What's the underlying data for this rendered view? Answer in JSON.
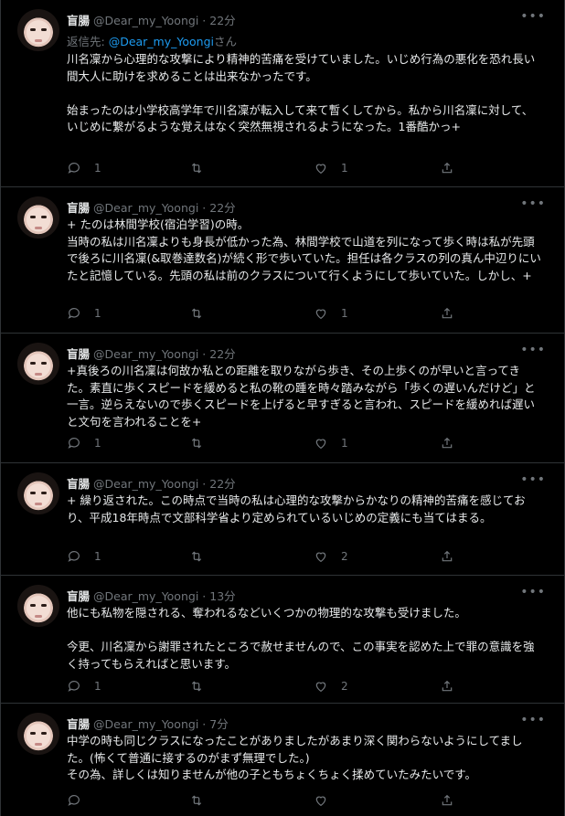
{
  "tweets": [
    {
      "name": "盲腸",
      "handle": "@Dear_my_Yoongi",
      "sep": "·",
      "time": "22分",
      "reply_prefix": "返信先: ",
      "reply_mention": "@Dear_my_Yoongi",
      "reply_suffix": "さん",
      "text": "川名凜から心理的な攻撃により精神的苦痛を受けていました。いじめ行為の悪化を恐れ長い間大人に助けを求めることは出来なかったです。\n\n始まったのは小学校高学年で川名凜が転入して来て暫くしてから。私から川名凜に対して、いじめに繋がるような覚えはなく突然無視されるようになった。1番酷かっ+",
      "replies": "1",
      "retweets": "",
      "likes": "1"
    },
    {
      "name": "盲腸",
      "handle": "@Dear_my_Yoongi",
      "sep": "·",
      "time": "22分",
      "text": "+ たのは林間学校(宿泊学習)の時。\n当時の私は川名凜よりも身長が低かった為、林間学校で山道を列になって歩く時は私が先頭で後ろに川名凜(&取巻達数名)が続く形で歩いていた。担任は各クラスの列の真ん中辺りにいたと記憶している。先頭の私は前のクラスについて行くようにして歩いていた。しかし、+",
      "replies": "1",
      "retweets": "",
      "likes": "1"
    },
    {
      "name": "盲腸",
      "handle": "@Dear_my_Yoongi",
      "sep": "·",
      "time": "22分",
      "text": "+真後ろの川名凜は何故か私との距離を取りながら歩き、その上歩くのが早いと言ってきた。素直に歩くスピードを緩めると私の靴の踵を時々踏みながら「歩くの遅いんだけど」と一言。逆らえないので歩くスピードを上げると早すぎると言われ、スピードを緩めれば遅いと文句を言われることを+",
      "replies": "1",
      "retweets": "",
      "likes": "1"
    },
    {
      "name": "盲腸",
      "handle": "@Dear_my_Yoongi",
      "sep": "·",
      "time": "22分",
      "text": "+ 繰り返された。この時点で当時の私は心理的な攻撃からかなりの精神的苦痛を感じており、平成18年時点で文部科学省より定められているいじめの定義にも当てはまる。",
      "replies": "1",
      "retweets": "",
      "likes": "2"
    },
    {
      "name": "盲腸",
      "handle": "@Dear_my_Yoongi",
      "sep": "·",
      "time": "13分",
      "text": "他にも私物を隠される、奪われるなどいくつかの物理的な攻撃も受けました。\n\n今更、川名凜から謝罪されたところで赦せませんので、この事実を認めた上で罪の意識を強く持ってもらえればと思います。",
      "replies": "1",
      "retweets": "",
      "likes": "2"
    },
    {
      "name": "盲腸",
      "handle": "@Dear_my_Yoongi",
      "sep": "·",
      "time": "7分",
      "text": "中学の時も同じクラスになったことがありましたがあまり深く関わらないようにしてました。(怖くて普通に接するのがまず無理でした。)\nその為、詳しくは知りませんが他の子ともちょくちょく揉めていたみたいです。",
      "replies": "",
      "retweets": "",
      "likes": ""
    }
  ],
  "icons": {
    "more": "more-icon",
    "reply": "reply-icon",
    "retweet": "retweet-icon",
    "like": "heart-icon",
    "share": "share-icon"
  },
  "colors": {
    "background": "#000000",
    "text": "#e7e9ea",
    "secondary": "#71767b",
    "link": "#1d9bf0",
    "border": "#2f3336"
  }
}
